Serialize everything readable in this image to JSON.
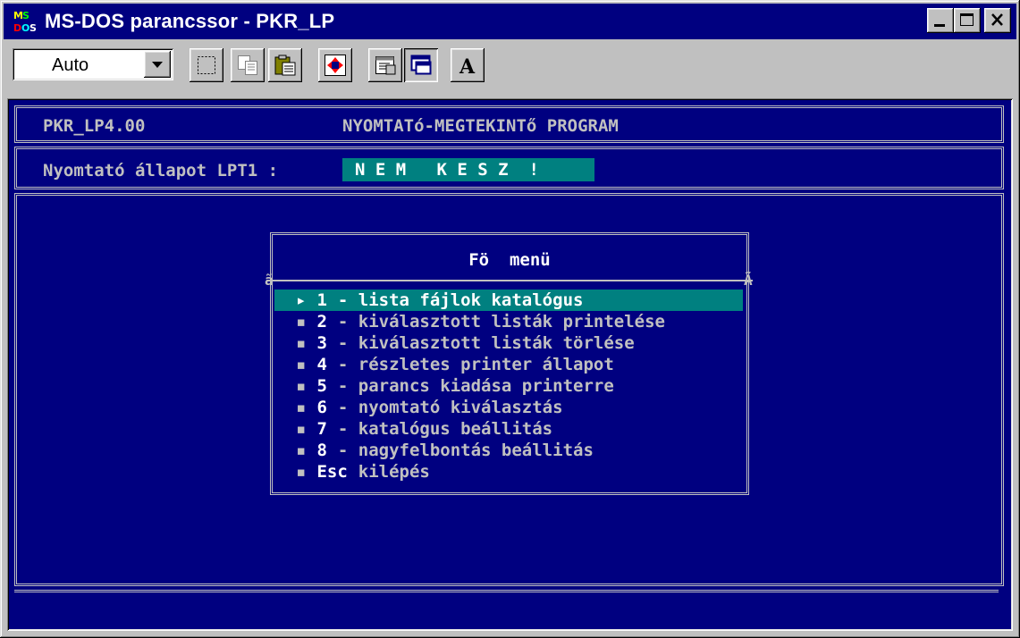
{
  "window": {
    "title": "MS-DOS parancssor - PKR_LP",
    "icon": "msdos-icon"
  },
  "toolbar": {
    "font_size_value": "Auto",
    "tools": [
      "mark-icon",
      "copy-icon",
      "paste-icon",
      "fullscreen-icon",
      "properties-icon",
      "background-icon",
      "font-icon"
    ],
    "font_tool_label": "A"
  },
  "console": {
    "program_id": "PKR_LP4.00",
    "program_name": "NYOMTATó-MEGTEKINTő PROGRAM",
    "status_label": "Nyomtató állapot LPT1 :",
    "status_value": "N E M   K E S Z  !"
  },
  "menu": {
    "title": "Fö  menü",
    "sep_left": "ã",
    "sep_right": "Ã",
    "items": [
      {
        "bullet": "▸",
        "key": "1",
        "text": "- lista fájlok katalógus"
      },
      {
        "bullet": "▪",
        "key": "2",
        "text": "- kiválasztott listák printelése"
      },
      {
        "bullet": "▪",
        "key": "3",
        "text": "- kiválasztott listák törlése"
      },
      {
        "bullet": "▪",
        "key": "4",
        "text": "- részletes printer állapot"
      },
      {
        "bullet": "▪",
        "key": "5",
        "text": "- parancs kiadása printerre"
      },
      {
        "bullet": "▪",
        "key": "6",
        "text": "- nyomtató kiválasztás"
      },
      {
        "bullet": "▪",
        "key": "7",
        "text": "- katalógus beállitás"
      },
      {
        "bullet": "▪",
        "key": "8",
        "text": "- nagyfelbontás beállitás"
      },
      {
        "bullet": "▪",
        "key": "Esc",
        "text": "kilépés"
      }
    ]
  },
  "colors": {
    "console_bg": "#000080",
    "highlight": "#008080",
    "text": "#c0c0c0"
  }
}
